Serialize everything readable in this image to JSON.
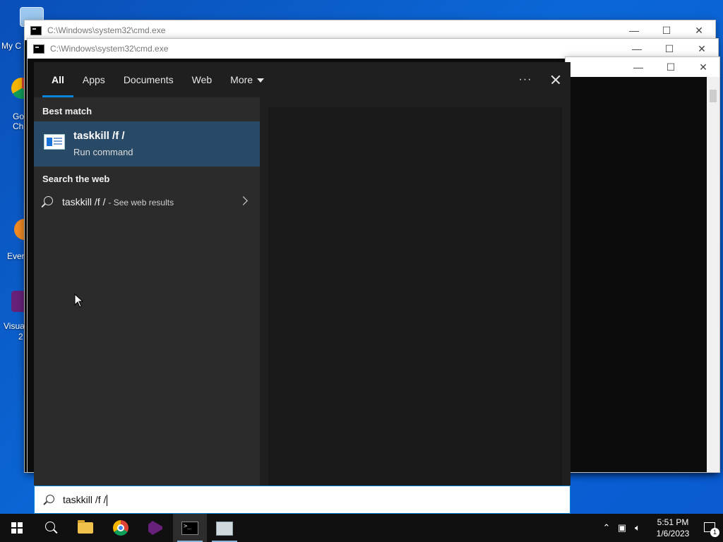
{
  "desktop": {
    "icons": [
      {
        "name": "my-computer",
        "label": "My C"
      },
      {
        "name": "google-chrome",
        "label": "Go\nCh"
      },
      {
        "name": "everything",
        "label": "Ever"
      },
      {
        "name": "visual-studio",
        "label": "Visua\n2"
      }
    ]
  },
  "cmd_windows": [
    {
      "title": "C:\\Windows\\system32\\cmd.exe"
    },
    {
      "title": "C:\\Windows\\system32\\cmd.exe"
    }
  ],
  "search_panel": {
    "tabs": [
      "All",
      "Apps",
      "Documents",
      "Web",
      "More"
    ],
    "active_tab": "All",
    "more_icon": "ellipsis-icon",
    "best_match_heading": "Best match",
    "best_match": {
      "title": "taskkill /f /",
      "subtitle": "Run command"
    },
    "web_heading": "Search the web",
    "web_result": {
      "query": "taskkill /f /",
      "hint": "- See web results"
    }
  },
  "search_box": {
    "value": "taskkill /f /"
  },
  "taskbar": {
    "clock_time": "5:51 PM",
    "clock_date": "1/6/2023",
    "notification_count": "1",
    "apps": [
      "file-explorer",
      "google-chrome",
      "visual-studio",
      "command-prompt",
      "network-app"
    ]
  },
  "colors": {
    "accent": "#0a84d8",
    "best_match_bg": "#294a66",
    "panel_bg": "#2b2b2b"
  }
}
